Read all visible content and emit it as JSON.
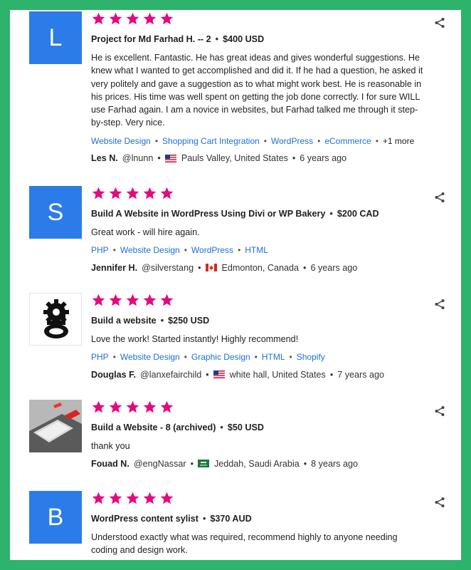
{
  "reviews": [
    {
      "avatar": {
        "type": "letter",
        "letter": "L"
      },
      "rating": 5,
      "project": "Project for Md Farhad H. -- 2",
      "price": "$400 USD",
      "text": "He is excellent. Fantastic. He has great ideas and gives wonderful suggestions. He knew what I wanted to get accomplished and did it. If he had a question, he asked it very politely and gave a suggestion as to what might work best. He is reasonable in his prices. His time was well spent on getting the job done correctly. I for sure WILL use Farhad again. I am a novice in websites, but Farhad talked me through it step-by-step. Very nice.",
      "tags": [
        "Website Design",
        "Shopping Cart Integration",
        "WordPress",
        "eCommerce"
      ],
      "more": "+1 more",
      "name": "Les N.",
      "handle": "@lnunn",
      "flag": "us",
      "location": "Pauls Valley, United States",
      "time": "6 years ago"
    },
    {
      "avatar": {
        "type": "letter",
        "letter": "S"
      },
      "rating": 5,
      "project": "Build A Website in WordPress Using Divi or WP Bakery",
      "price": "$200 CAD",
      "text": "Great work - will hire again.",
      "tags": [
        "PHP",
        "Website Design",
        "WordPress",
        "HTML"
      ],
      "more": "",
      "name": "Jennifer H.",
      "handle": "@silverstang",
      "flag": "ca",
      "location": "Edmonton, Canada",
      "time": "6 years ago"
    },
    {
      "avatar": {
        "type": "logo",
        "letter": "g"
      },
      "rating": 5,
      "project": "Build a website",
      "price": "$250 USD",
      "text": "Love the work! Started instantly! Highly recommend!",
      "tags": [
        "PHP",
        "Website Design",
        "Graphic Design",
        "HTML",
        "Shopify"
      ],
      "more": "",
      "name": "Douglas F.",
      "handle": "@lanxefairchild",
      "flag": "us",
      "location": "white hall, United States",
      "time": "7 years ago"
    },
    {
      "avatar": {
        "type": "photo",
        "letter": ""
      },
      "rating": 5,
      "project": "Build a Website - 8 (archived)",
      "price": "$50 USD",
      "text": "thank you",
      "tags": [],
      "more": "",
      "name": "Fouad N.",
      "handle": "@engNassar",
      "flag": "sa",
      "location": "Jeddah, Saudi Arabia",
      "time": "8 years ago"
    },
    {
      "avatar": {
        "type": "letter",
        "letter": "B"
      },
      "rating": 5,
      "project": "WordPress content sylist",
      "price": "$370 AUD",
      "text": "Understood exactly what was required, recommend highly to anyone needing coding and design work.",
      "tags": [],
      "more": "",
      "name": "",
      "handle": "",
      "flag": "",
      "location": "",
      "time": ""
    }
  ],
  "colors": {
    "frame": "#2db36b",
    "star": "#e5087e",
    "avatar": "#2b7ce9",
    "tag": "#1f6fd8"
  }
}
